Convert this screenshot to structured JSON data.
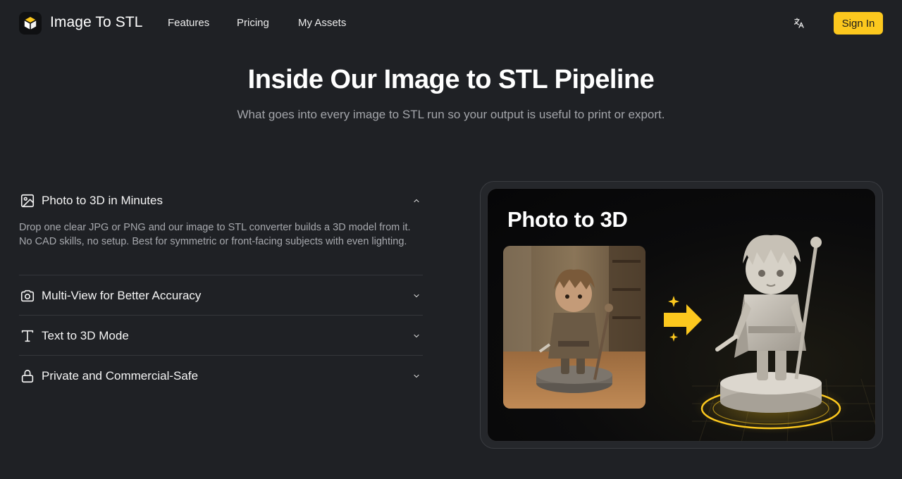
{
  "header": {
    "brand": "Image To STL",
    "nav": [
      "Features",
      "Pricing",
      "My Assets"
    ],
    "sign_in": "Sign In",
    "icons": {
      "logo": "cube-icon",
      "language": "translate-icon"
    }
  },
  "hero": {
    "title": "Inside Our Image to STL Pipeline",
    "subtitle": "What goes into every image to STL run so your output is useful to print or export."
  },
  "accordion": [
    {
      "icon": "image-icon",
      "title": "Photo to 3D in Minutes",
      "expanded": true,
      "body": "Drop one clear JPG or PNG and our image to STL converter builds a 3D model from it. No CAD skills, no setup. Best for symmetric or front-facing subjects with even lighting."
    },
    {
      "icon": "camera-icon",
      "title": "Multi-View for Better Accuracy",
      "expanded": false
    },
    {
      "icon": "text-icon",
      "title": "Text to 3D Mode",
      "expanded": false
    },
    {
      "icon": "lock-icon",
      "title": "Private and Commercial-Safe",
      "expanded": false
    }
  ],
  "preview": {
    "title": "Photo to 3D",
    "accent_color": "#fcc81e"
  },
  "colors": {
    "background": "#1f2125",
    "accent": "#fcc81e"
  }
}
